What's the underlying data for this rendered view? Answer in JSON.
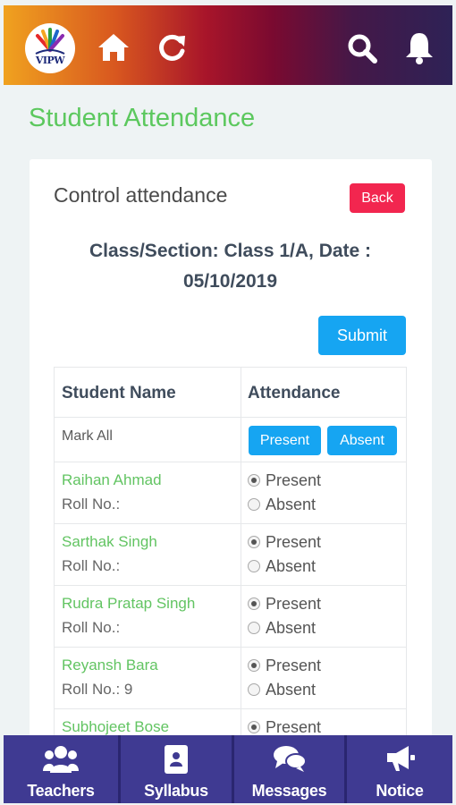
{
  "header": {
    "logo_text": "VIPW",
    "icons": [
      "home-icon",
      "refresh-icon",
      "search-icon",
      "bell-icon"
    ]
  },
  "page_title": "Student Attendance",
  "card": {
    "title": "Control attendance",
    "back_label": "Back",
    "class_line_1": "Class/Section: Class 1/A, Date :",
    "class_line_2": "05/10/2019",
    "submit_label": "Submit"
  },
  "table": {
    "headers": {
      "name": "Student Name",
      "attendance": "Attendance"
    },
    "mark_all": {
      "label": "Mark All",
      "present_label": "Present",
      "absent_label": "Absent"
    },
    "option_present": "Present",
    "option_absent": "Absent",
    "students": [
      {
        "name": "Raihan Ahmad",
        "roll": "Roll No.:",
        "selected": "Present"
      },
      {
        "name": "Sarthak Singh",
        "roll": "Roll No.:",
        "selected": "Present"
      },
      {
        "name": "Rudra Pratap Singh",
        "roll": "Roll No.:",
        "selected": "Present"
      },
      {
        "name": "Reyansh Bara",
        "roll": "Roll No.: 9",
        "selected": "Present"
      },
      {
        "name": "Subhojeet Bose",
        "roll": "",
        "selected": "Present"
      }
    ]
  },
  "bottom_nav": [
    {
      "label": "Teachers",
      "icon": "users-icon"
    },
    {
      "label": "Syllabus",
      "icon": "syllabus-book-icon"
    },
    {
      "label": "Messages",
      "icon": "chat-bubbles-icon"
    },
    {
      "label": "Notice",
      "icon": "megaphone-icon"
    }
  ],
  "colors": {
    "accent_green": "#5cc85e",
    "button_blue": "#16a5f2",
    "back_red": "#f2264f",
    "nav_purple": "#3f3a92"
  }
}
